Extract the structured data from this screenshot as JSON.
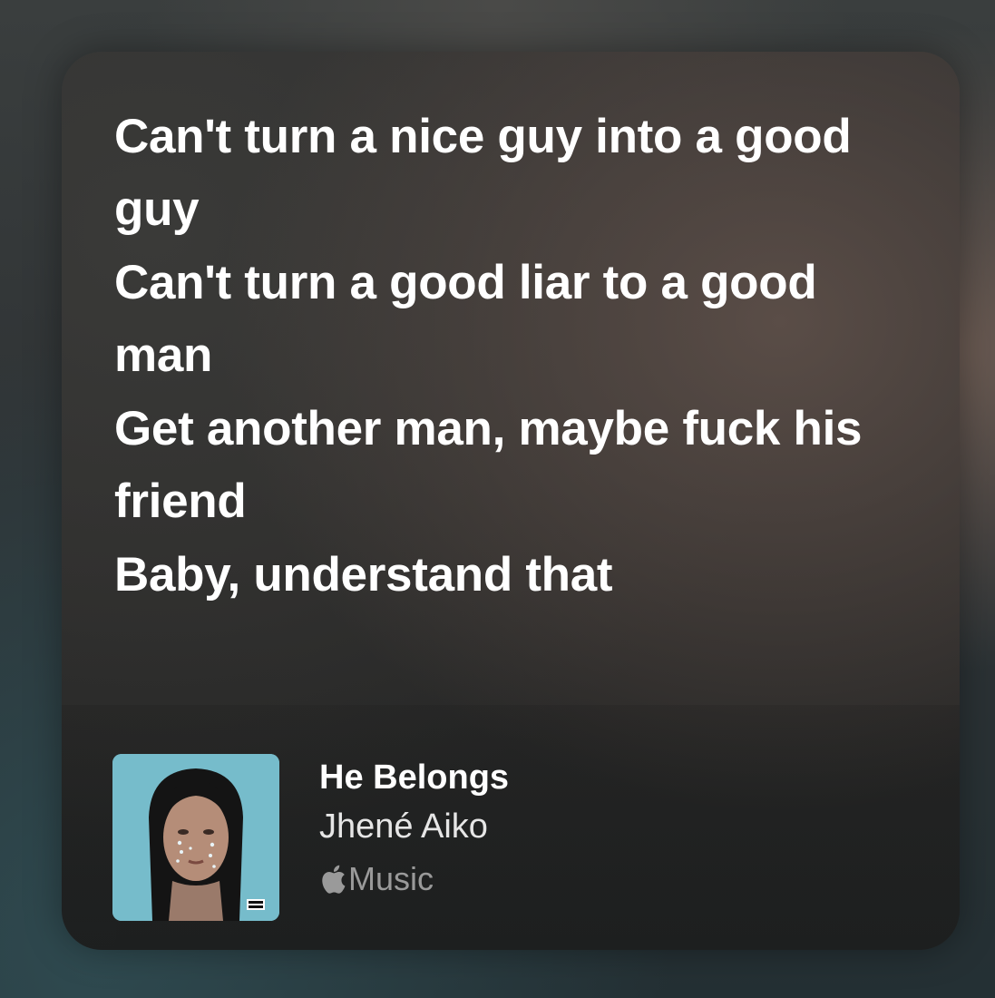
{
  "lyrics": {
    "lines": [
      "Can't turn a nice guy into a good guy",
      "Can't turn a good liar to a good man",
      "Get another man, maybe fuck his friend",
      "Baby, understand that"
    ]
  },
  "track": {
    "title": "He Belongs",
    "artist": "Jhené Aiko",
    "service": "Music",
    "service_icon": "apple-logo-icon",
    "album_art": "album-cover-image"
  },
  "colors": {
    "text_primary": "#ffffff",
    "text_secondary": "#e6e6e6",
    "text_tertiary": "#9a9a9a",
    "album_background": "#7fc3cf"
  }
}
